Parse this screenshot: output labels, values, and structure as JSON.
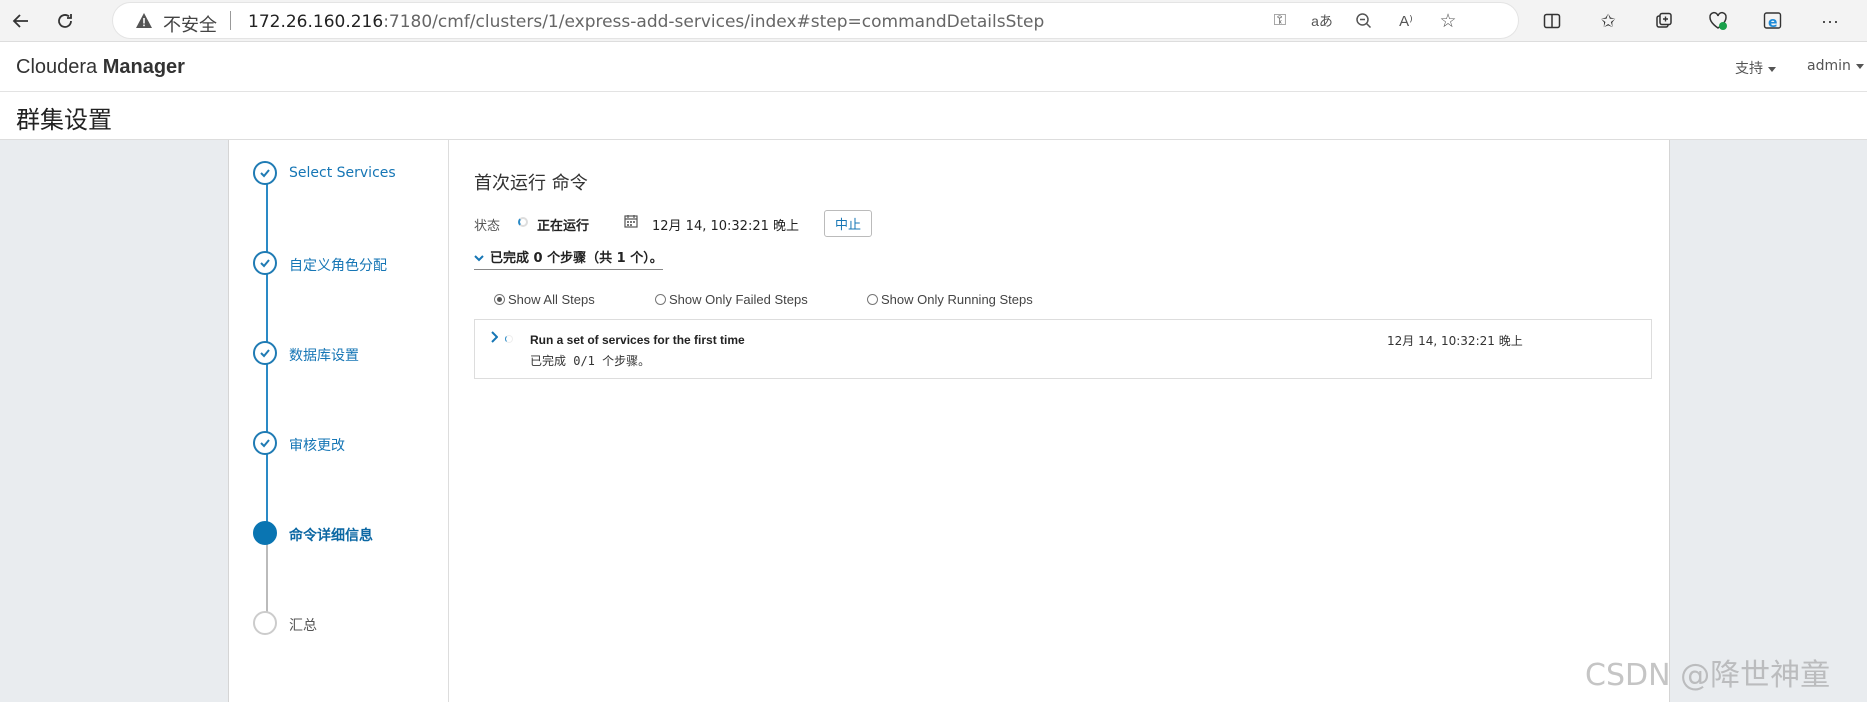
{
  "browser": {
    "insecure_label": "不安全",
    "url_host": "172.26.160.216",
    "url_rest": ":7180/cmf/clusters/1/express-add-services/index#step=commandDetailsStep"
  },
  "header": {
    "brand_light": "Cloudera ",
    "brand_bold": "Manager",
    "support_menu": "支持",
    "user_menu": "admin"
  },
  "page": {
    "title": "群集设置"
  },
  "wizard": {
    "steps": [
      {
        "label": "Select Services",
        "state": "done"
      },
      {
        "label": "自定义角色分配",
        "state": "done"
      },
      {
        "label": "数据库设置",
        "state": "done"
      },
      {
        "label": "审核更改",
        "state": "done"
      },
      {
        "label": "命令详细信息",
        "state": "active"
      },
      {
        "label": "汇总",
        "state": "future"
      }
    ]
  },
  "command": {
    "title": "首次运行 命令",
    "status_label": "状态",
    "status_value": "正在运行",
    "timestamp": "12月 14, 10:32:21 晚上",
    "abort_label": "中止",
    "summary": "已完成 0 个步骤（共 1 个）。",
    "filters": [
      {
        "label": "Show All Steps",
        "selected": true
      },
      {
        "label": "Show Only Failed Steps",
        "selected": false
      },
      {
        "label": "Show Only Running Steps",
        "selected": false
      }
    ],
    "steps": [
      {
        "name": "Run a set of services for the first time",
        "progress": "已完成 0/1 个步骤。",
        "timestamp": "12月 14, 10:32:21 晚上"
      }
    ]
  },
  "watermark": "CSDN @降世神童",
  "colors": {
    "accent": "#0a75b2",
    "link": "#1676b5",
    "content_bg": "#e9ecef"
  }
}
